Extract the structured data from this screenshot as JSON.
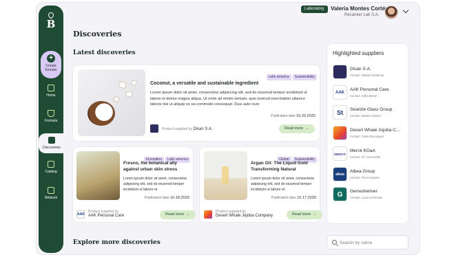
{
  "header": {
    "badge": "Laboratory",
    "user_name": "Valeria Montes Cortés",
    "user_company": "Recamier Lab S.A."
  },
  "sidebar": {
    "logo": "B",
    "create_label": "Create formula",
    "items": [
      {
        "label": "Home",
        "icon": "home-icon"
      },
      {
        "label": "Formula",
        "icon": "flask-icon"
      },
      {
        "label": "Discoveries",
        "icon": "discoveries-icon",
        "active": true
      },
      {
        "label": "Catalog",
        "icon": "catalog-icon"
      },
      {
        "label": "Network",
        "icon": "network-icon"
      }
    ]
  },
  "main": {
    "page_title": "Discoveries",
    "section_title": "Latest discoveries",
    "explore_title": "Explore more discoveries",
    "featured": {
      "tags": [
        "Latin america",
        "Sustainability"
      ],
      "title": "Coconut, a versatile and sustainable ingredient",
      "body": "Lorem ipsum dolor sit amet, consectetur adipiscing elit, sed do eiusmod tempor incididunt ut labore et dolore magna aliqua. Ut enim ad minim veniam, quis nostrud exercitation ullamco laboris nisi ut aliquip ex ea commodo consequat. Duis aute irure",
      "date_label": "Publication date",
      "date": "10.20.2025",
      "supplied_label": "Product supplied by",
      "supplier": "Disan S.A.",
      "button": "Read more"
    },
    "cards": [
      {
        "tags": [
          "Innovation",
          "Latin america"
        ],
        "title": "Fresno, the botanical ally against urban skin stress",
        "body": "Lorem ipsum dolor sit amet, consectetur adipiscing elit, sed do eiusmod tempor incididunt ut labore et",
        "date_label": "Publication date",
        "date": "10.18.2025",
        "supplied_label": "Product supplied by",
        "supplier": "AAK Personal Care",
        "button": "Read more"
      },
      {
        "tags": [
          "Global",
          "Sustainability"
        ],
        "title": "Argan Oil: The Liquid Gold Transforming Natural Cosmeti...",
        "body": "Lorem ipsum dolor sit amet, consectetur adipiscing elit, sed do eiusmod tempor incididunt ut labore et",
        "date_label": "Publication date",
        "date": "10.17.2025",
        "supplied_label": "Product supplied by",
        "supplier": "Desert Whale Jojoba Company",
        "button": "Read more"
      }
    ]
  },
  "suppliers": {
    "title": "Highlighted suppliers",
    "contact_label": "Contact:",
    "items": [
      {
        "name": "Disan S.A.",
        "contact": "Natalia Cárdenas",
        "color": "#2b2b5e"
      },
      {
        "name": "AAK Personal Care",
        "contact": "Sofía Brown",
        "color": "#ffffff"
      },
      {
        "name": "Stoelzle Glass Group",
        "contact": "Markus Steiner",
        "color": "#1e3a7a"
      },
      {
        "name": "Desert Whale Jojoba C...",
        "contact": "Carla Domínguez",
        "color": "#e8452c"
      },
      {
        "name": "Merck KGaA",
        "contact": "Dr. Anna Keller",
        "color": "#ffffff"
      },
      {
        "name": "Albea Group",
        "contact": "Pierre Dupont",
        "color": "#1a3d7c"
      },
      {
        "name": "Gerresheimer",
        "contact": "Laura Schneider",
        "color": "#0f6b5e"
      }
    ]
  },
  "search": {
    "placeholder": "Search by name"
  }
}
